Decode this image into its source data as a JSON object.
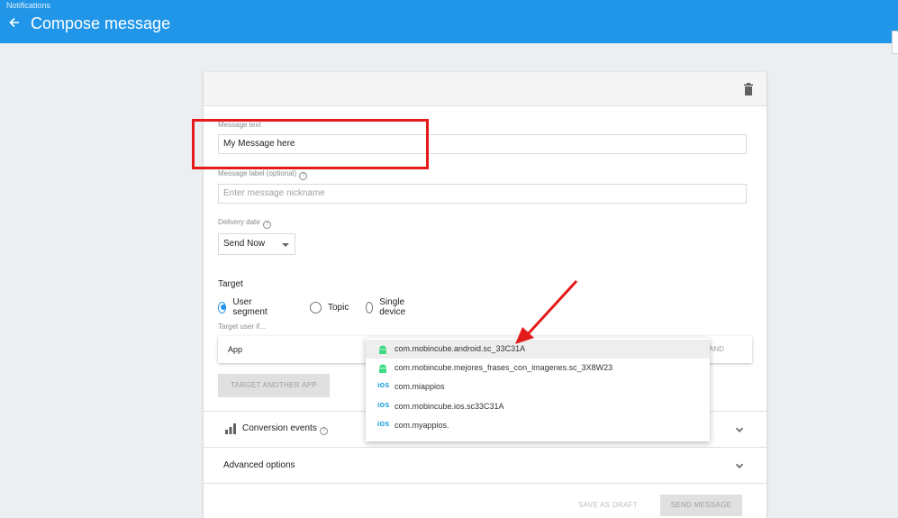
{
  "header": {
    "breadcrumb": "Notifications",
    "title": "Compose message",
    "back_icon": "arrow-left-icon"
  },
  "composer": {
    "delete_icon": "trash-icon",
    "message_text": {
      "label": "Message text",
      "value": "My Message here"
    },
    "message_label": {
      "label": "Message label (optional)",
      "placeholder": "Enter message nickname",
      "help_icon": "help-icon"
    },
    "delivery": {
      "label": "Delivery date",
      "help_icon": "help-icon",
      "selected": "Send Now"
    },
    "target": {
      "title": "Target",
      "options": [
        "User segment",
        "Topic",
        "Single device"
      ],
      "selected": "User segment",
      "condition_label": "Target user if...",
      "app_field": "App",
      "and_button": "AND",
      "target_another_app": "TARGET ANOTHER APP"
    },
    "conversion_events": {
      "label": "Conversion events",
      "icon": "bar-chart-icon",
      "help_icon": "help-icon"
    },
    "advanced_options": {
      "label": "Advanced options"
    },
    "save_draft": "SAVE AS DRAFT",
    "send_message": "SEND MESSAGE"
  },
  "app_dropdown": {
    "items": [
      {
        "platform": "android",
        "name": "com.mobincube.android.sc_33C31A",
        "highlighted": true
      },
      {
        "platform": "android",
        "name": "com.mobincube.mejores_frases_con_imagenes.sc_3X8W23",
        "highlighted": false
      },
      {
        "platform": "ios",
        "name": "com.miappios",
        "highlighted": false
      },
      {
        "platform": "ios",
        "name": "com.mobincube.ios.sc33C31A",
        "highlighted": false
      },
      {
        "platform": "ios",
        "name": "com.myappios.",
        "highlighted": false
      }
    ],
    "ios_badge": "iOS"
  },
  "colors": {
    "header_bg": "#2196e8",
    "accent": "#2196e8",
    "annotation": "#e31b1b",
    "android_green": "#3ddc84",
    "ios_blue": "#29a8e0"
  }
}
